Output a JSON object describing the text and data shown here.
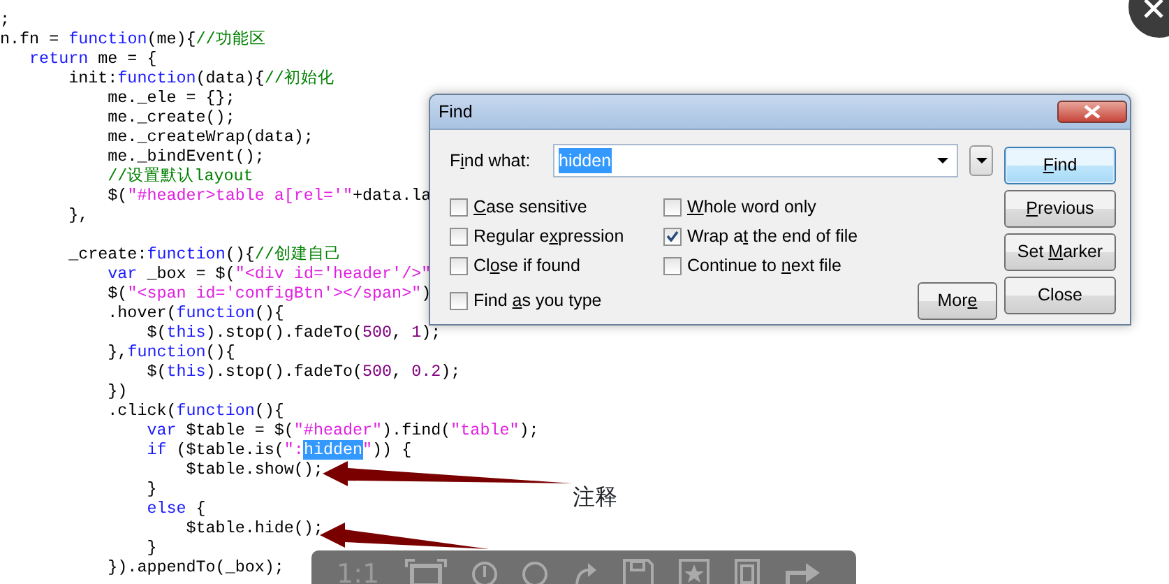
{
  "editor": {
    "lines": [
      {
        "segments": [
          {
            "kind": "plain",
            "text": ";"
          }
        ]
      },
      {
        "segments": [
          {
            "kind": "plain",
            "text": "n.fn = "
          },
          {
            "kind": "keyword",
            "text": "function"
          },
          {
            "kind": "plain",
            "text": "(me){"
          },
          {
            "kind": "comment",
            "text": "//功能区"
          }
        ]
      },
      {
        "segments": [
          {
            "kind": "keyword",
            "text": "   return"
          },
          {
            "kind": "plain",
            "text": " me = {"
          }
        ]
      },
      {
        "segments": [
          {
            "kind": "plain",
            "text": "       init:"
          },
          {
            "kind": "keyword",
            "text": "function"
          },
          {
            "kind": "plain",
            "text": "(data){"
          },
          {
            "kind": "comment",
            "text": "//初始化"
          }
        ]
      },
      {
        "segments": [
          {
            "kind": "plain",
            "text": "           me._ele = {};"
          }
        ]
      },
      {
        "segments": [
          {
            "kind": "plain",
            "text": "           me._create();"
          }
        ]
      },
      {
        "segments": [
          {
            "kind": "plain",
            "text": "           me._createWrap(data);"
          }
        ]
      },
      {
        "segments": [
          {
            "kind": "plain",
            "text": "           me._bindEvent();"
          }
        ]
      },
      {
        "segments": [
          {
            "kind": "comment",
            "text": "           //设置默认layout"
          }
        ]
      },
      {
        "segments": [
          {
            "kind": "plain",
            "text": "           $("
          },
          {
            "kind": "string",
            "text": "\"#header>table a[rel='\""
          },
          {
            "kind": "plain",
            "text": "+data.la"
          }
        ]
      },
      {
        "segments": [
          {
            "kind": "plain",
            "text": "       },"
          }
        ]
      },
      {
        "blank_line_before": true,
        "segments": [
          {
            "kind": "plain",
            "text": "       _create:"
          },
          {
            "kind": "keyword",
            "text": "function"
          },
          {
            "kind": "plain",
            "text": "(){"
          },
          {
            "kind": "comment",
            "text": "//创建自己"
          }
        ]
      },
      {
        "segments": [
          {
            "kind": "keyword",
            "text": "           var"
          },
          {
            "kind": "plain",
            "text": " _box = $("
          },
          {
            "kind": "string",
            "text": "\"<div id='header'/>\""
          }
        ]
      },
      {
        "segments": [
          {
            "kind": "plain",
            "text": "           $("
          },
          {
            "kind": "string",
            "text": "\"<span id='configBtn'></span>\""
          },
          {
            "kind": "plain",
            "text": ")"
          }
        ]
      },
      {
        "segments": [
          {
            "kind": "plain",
            "text": "           .hover("
          },
          {
            "kind": "keyword",
            "text": "function"
          },
          {
            "kind": "plain",
            "text": "(){"
          }
        ]
      },
      {
        "segments": [
          {
            "kind": "plain",
            "text": "               $("
          },
          {
            "kind": "keyword",
            "text": "this"
          },
          {
            "kind": "plain",
            "text": ").stop().fadeTo("
          },
          {
            "kind": "number",
            "text": "500"
          },
          {
            "kind": "plain",
            "text": ", "
          },
          {
            "kind": "number",
            "text": "1"
          },
          {
            "kind": "plain",
            "text": ");"
          }
        ]
      },
      {
        "segments": [
          {
            "kind": "plain",
            "text": "           },"
          },
          {
            "kind": "keyword",
            "text": "function"
          },
          {
            "kind": "plain",
            "text": "(){"
          }
        ]
      },
      {
        "segments": [
          {
            "kind": "plain",
            "text": "               $("
          },
          {
            "kind": "keyword",
            "text": "this"
          },
          {
            "kind": "plain",
            "text": ").stop().fadeTo("
          },
          {
            "kind": "number",
            "text": "500"
          },
          {
            "kind": "plain",
            "text": ", "
          },
          {
            "kind": "number",
            "text": "0.2"
          },
          {
            "kind": "plain",
            "text": ");"
          }
        ]
      },
      {
        "segments": [
          {
            "kind": "plain",
            "text": "           })"
          }
        ]
      },
      {
        "segments": [
          {
            "kind": "plain",
            "text": "           .click("
          },
          {
            "kind": "keyword",
            "text": "function"
          },
          {
            "kind": "plain",
            "text": "(){"
          }
        ]
      },
      {
        "segments": [
          {
            "kind": "keyword",
            "text": "               var"
          },
          {
            "kind": "plain",
            "text": " $table = $("
          },
          {
            "kind": "string",
            "text": "\"#header\""
          },
          {
            "kind": "plain",
            "text": ").find("
          },
          {
            "kind": "string",
            "text": "\"table\""
          },
          {
            "kind": "plain",
            "text": ");"
          }
        ]
      },
      {
        "segments": [
          {
            "kind": "keyword",
            "text": "               if"
          },
          {
            "kind": "plain",
            "text": " ($table.is("
          },
          {
            "kind": "string",
            "text": "\":"
          },
          {
            "kind": "selection",
            "text": "hidden"
          },
          {
            "kind": "string",
            "text": "\""
          },
          {
            "kind": "plain",
            "text": ")) {"
          }
        ]
      },
      {
        "segments": [
          {
            "kind": "plain",
            "text": "                   $table.show();"
          }
        ]
      },
      {
        "segments": [
          {
            "kind": "plain",
            "text": "               }"
          }
        ]
      },
      {
        "segments": [
          {
            "kind": "keyword",
            "text": "               else"
          },
          {
            "kind": "plain",
            "text": " {"
          }
        ]
      },
      {
        "segments": [
          {
            "kind": "plain",
            "text": "                   $table.hide();"
          }
        ]
      },
      {
        "segments": [
          {
            "kind": "plain",
            "text": "               }"
          }
        ]
      },
      {
        "segments": [
          {
            "kind": "plain",
            "text": "           }).appendTo(_box);"
          }
        ]
      }
    ]
  },
  "annotation": {
    "text": "注释"
  },
  "find_dialog": {
    "title": "Find",
    "find_what": {
      "label": {
        "before": "F",
        "key": "i",
        "after": "nd what:"
      },
      "value": "hidden",
      "value_selected": true
    },
    "options": [
      {
        "label": {
          "key": "C",
          "after": "ase sensitive"
        },
        "checked": false
      },
      {
        "label": {
          "key": "W",
          "after": "hole word only"
        },
        "checked": false
      },
      {
        "label": {
          "before": "Regular e",
          "key": "x",
          "after": "pression"
        },
        "checked": false
      },
      {
        "label": {
          "before": "Wrap a",
          "key": "t",
          "after": " the end of file"
        },
        "checked": true
      },
      {
        "label": {
          "before": "Cl",
          "key": "o",
          "after": "se if found"
        },
        "checked": false
      },
      {
        "label": {
          "before": "Continue to ",
          "key": "n",
          "after": "ext file"
        },
        "checked": false
      },
      {
        "label": {
          "before": "Find ",
          "key": "a",
          "after": "s you type"
        },
        "checked": false
      }
    ],
    "buttons": [
      {
        "label": {
          "key": "F",
          "after": "ind"
        },
        "focused": true
      },
      {
        "label": {
          "key": "P",
          "after": "revious"
        },
        "focused": false
      },
      {
        "label": {
          "before": "Set ",
          "key": "M",
          "after": "arker"
        },
        "focused": false
      },
      {
        "label": {
          "before": "Close"
        },
        "focused": false
      }
    ],
    "more_button": {
      "label": {
        "before": "Mor",
        "key": "e"
      },
      "focused": false
    }
  },
  "image_viewer_toolbar": {
    "actual_size_label": "1:1"
  }
}
